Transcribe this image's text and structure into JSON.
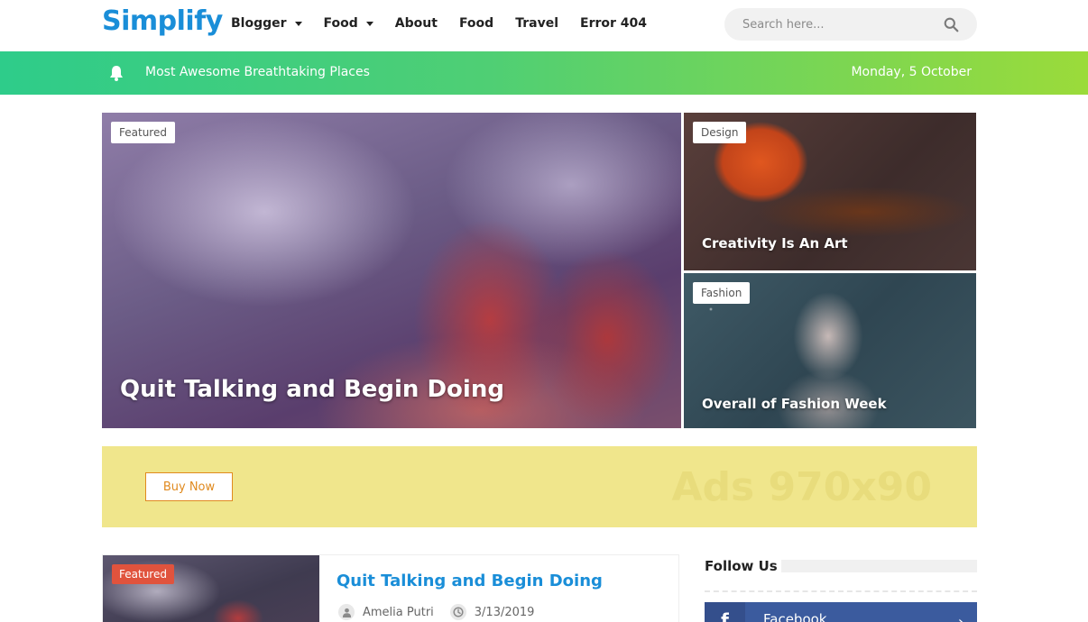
{
  "header": {
    "logo": "Simplify",
    "nav": [
      {
        "label": "Blogger",
        "dropdown": true
      },
      {
        "label": "Food",
        "dropdown": true
      },
      {
        "label": "About",
        "dropdown": false
      },
      {
        "label": "Food",
        "dropdown": false
      },
      {
        "label": "Travel",
        "dropdown": false
      },
      {
        "label": "Error 404",
        "dropdown": false
      }
    ],
    "search": {
      "placeholder": "Search here...",
      "icon": "search-icon"
    }
  },
  "topbar": {
    "icon": "bell-icon",
    "text": "Most Awesome Breathtaking Places",
    "date": "Monday, 5 October"
  },
  "featured": {
    "main": {
      "tag": "Featured",
      "title": "Quit Talking and Begin Doing"
    },
    "design": {
      "tag": "Design",
      "title": "Creativity Is An Art"
    },
    "fashion": {
      "tag": "Fashion",
      "title": "Overall of Fashion Week"
    }
  },
  "ad": {
    "button": "Buy Now",
    "text": "Ads 970x90"
  },
  "post": {
    "tag": "Featured",
    "title": "Quit Talking and Begin Doing",
    "author": "Amelia Putri",
    "date": "3/13/2019"
  },
  "sidebar": {
    "follow_title": "Follow Us",
    "facebook": {
      "icon_letter": "f",
      "label": "Facebook",
      "chevron": "›"
    }
  },
  "colors": {
    "brand": "#1a8ed8",
    "topbar_start": "#2ecc8a",
    "topbar_end": "#9bdb3a",
    "ad_bg": "#f0e68c",
    "tag_red": "#e0533d",
    "facebook": "#3b5b9e"
  }
}
